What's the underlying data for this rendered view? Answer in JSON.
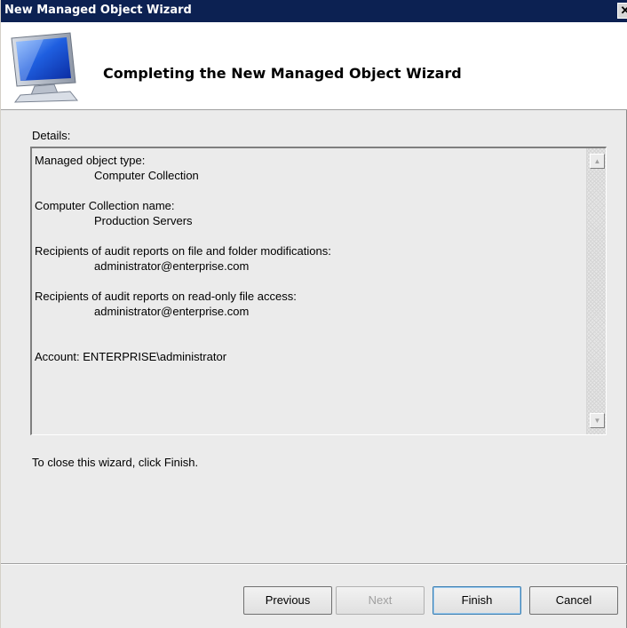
{
  "window": {
    "title": "New Managed Object Wizard",
    "close_glyph": "✕"
  },
  "header": {
    "heading": "Completing the New Managed Object Wizard",
    "icon": "monitor-icon"
  },
  "details": {
    "label": "Details:",
    "blocks": [
      {
        "label": "Managed object type:",
        "value": "Computer Collection"
      },
      {
        "label": "Computer Collection name:",
        "value": "Production Servers"
      },
      {
        "label": "Recipients of audit reports on file and folder modifications:",
        "value": "administrator@enterprise.com"
      },
      {
        "label": "Recipients of audit reports on read-only file access:",
        "value": "administrator@enterprise.com"
      }
    ],
    "account_line": "Account: ENTERPRISE\\administrator",
    "scroll_up_glyph": "▲",
    "scroll_down_glyph": "▼"
  },
  "close_hint": "To close this wizard, click Finish.",
  "buttons": {
    "previous": "Previous",
    "next": "Next",
    "finish": "Finish",
    "cancel": "Cancel"
  },
  "colors": {
    "titlebar": "#0c2152",
    "window_bg": "#ebebeb",
    "header_bg": "#ffffff"
  }
}
